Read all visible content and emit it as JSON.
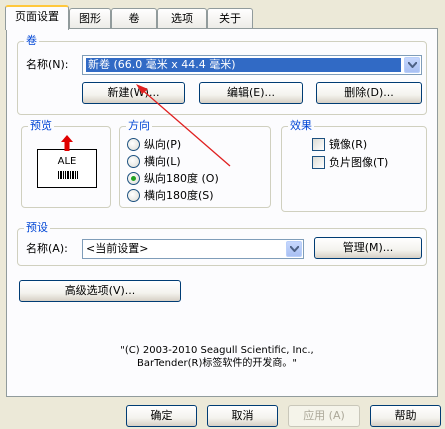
{
  "tabs": [
    {
      "label": "页面设置",
      "active": true
    },
    {
      "label": "图形",
      "active": false
    },
    {
      "label": "卷",
      "active": false
    },
    {
      "label": "选项",
      "active": false
    },
    {
      "label": "关于",
      "active": false
    }
  ],
  "roll": {
    "title": "卷",
    "name_label": "名称(N):",
    "name_value": "新卷 (66.0 毫米 x 44.4 毫米)",
    "new_button": "新建(W)...",
    "edit_button": "编辑(E)...",
    "delete_button": "删除(D)..."
  },
  "preview": {
    "title": "预览",
    "sample_text": "ALE"
  },
  "orientation": {
    "title": "方向",
    "options": [
      {
        "label": "纵向(P)",
        "selected": false
      },
      {
        "label": "横向(L)",
        "selected": false
      },
      {
        "label": "纵向180度 (O)",
        "selected": true
      },
      {
        "label": "横向180度(S)",
        "selected": false
      }
    ]
  },
  "effects": {
    "title": "效果",
    "options": [
      {
        "label": "镜像(R)",
        "checked": false
      },
      {
        "label": "负片图像(T)",
        "checked": false
      }
    ]
  },
  "preset": {
    "title": "预设",
    "name_label": "名称(A):",
    "name_value": "<当前设置>",
    "manage_button": "管理(M)..."
  },
  "advanced_button": "高级选项(V)...",
  "copyright": {
    "line1": "\"(C) 2003-2010 Seagull Scientific, Inc.,",
    "line2": "BarTender(R)标签软件的开发商。\""
  },
  "footer": {
    "ok": "确定",
    "cancel": "取消",
    "apply": "应用 (A)",
    "help": "帮助"
  },
  "colors": {
    "accent": "#316ac5",
    "arrow_annotation": "#e02020",
    "group_title": "#0046d5"
  }
}
